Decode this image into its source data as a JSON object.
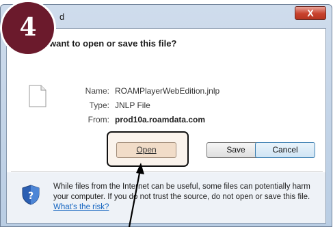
{
  "window": {
    "title_fragment": "d",
    "close_glyph": "X"
  },
  "dialog": {
    "question": "want to open or save this file?",
    "name_label": "Name:",
    "name_value": "ROAMPlayerWebEdition.jnlp",
    "type_label": "Type:",
    "type_value": "JNLP File",
    "from_label": "From:",
    "from_value": "prod10a.roamdata.com",
    "open_label": "Open",
    "save_label": "Save",
    "cancel_label": "Cancel"
  },
  "footer": {
    "line1": "While files from the Internet can be useful, some files can potentially harm",
    "line2": "your computer. If you do not trust the source, do not open or save this file.",
    "risk_link": "What's the risk?"
  },
  "badge": {
    "number": "4",
    "color": "#6b1a2c"
  },
  "icons": {
    "file": "file-icon",
    "shield": "shield-icon",
    "arrow": "arrow-icon"
  }
}
